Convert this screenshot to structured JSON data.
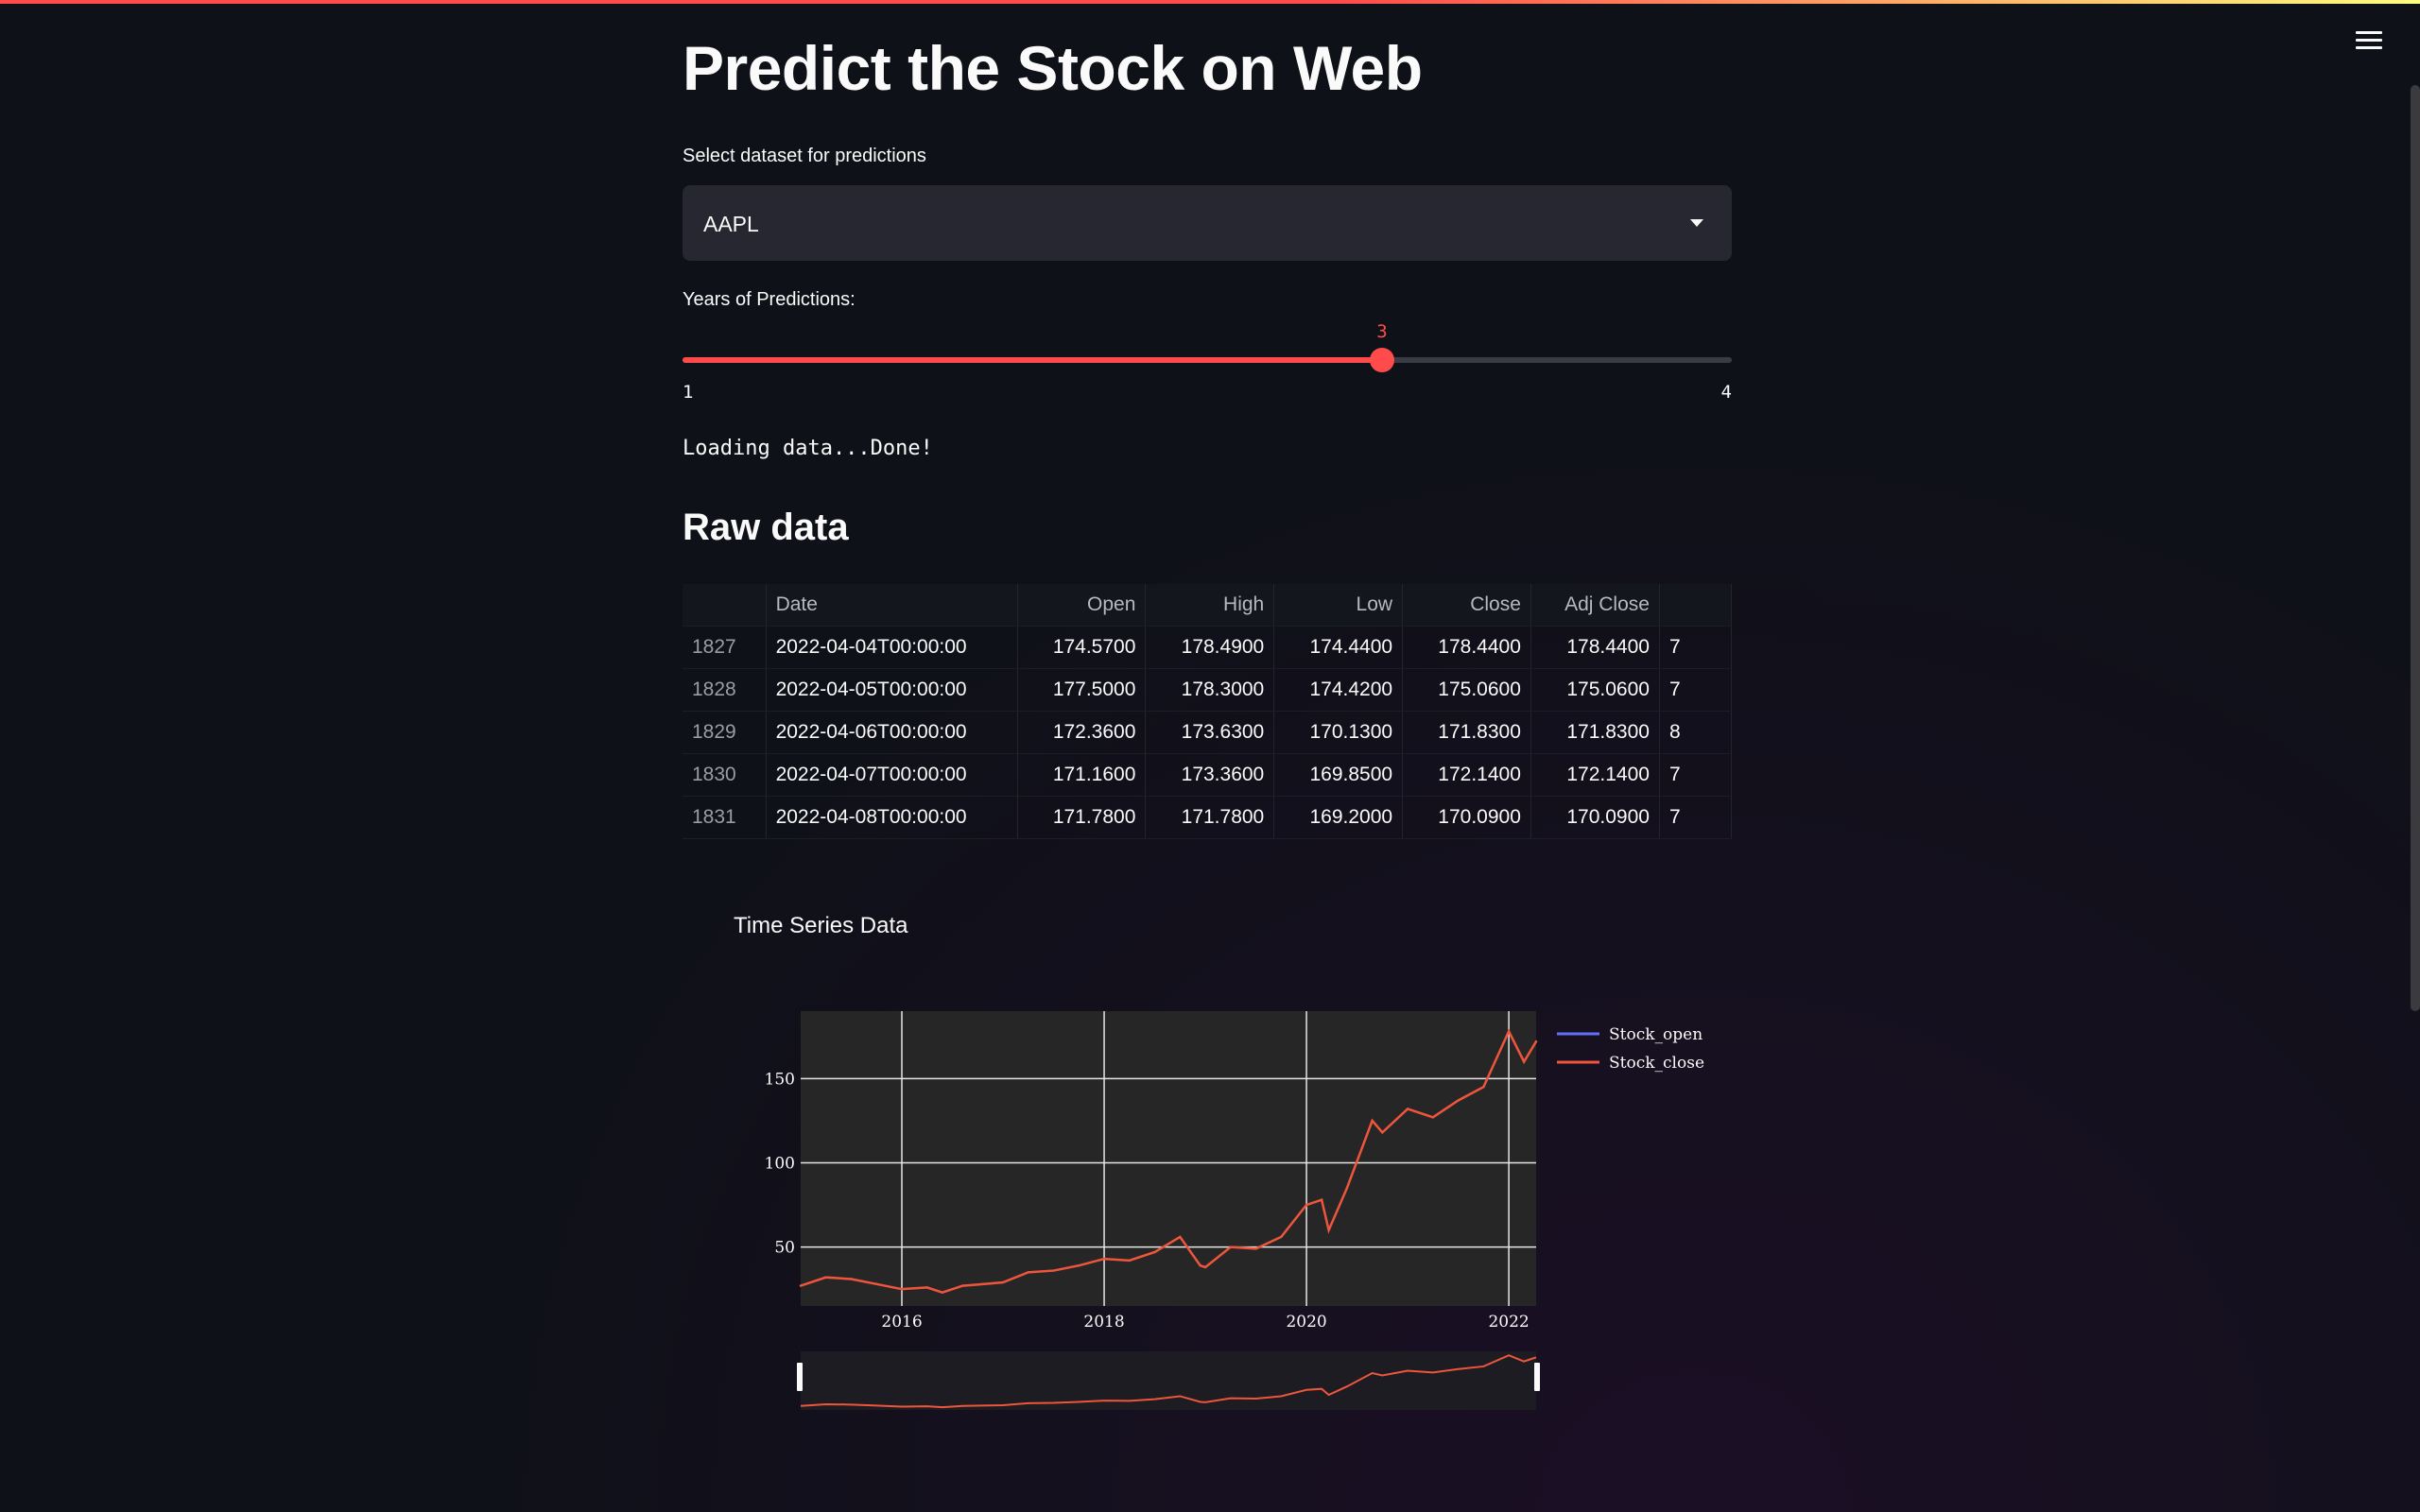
{
  "app": {
    "title": "Predict the Stock on Web",
    "menu_icon": "hamburger-icon"
  },
  "dataset_select": {
    "label": "Select dataset for predictions",
    "value": "AAPL"
  },
  "years_slider": {
    "label": "Years of Predictions:",
    "value": 3,
    "min": 1,
    "max": 4
  },
  "status_text": "Loading data...Done!",
  "raw_data": {
    "heading": "Raw data",
    "columns": [
      "",
      "Date",
      "Open",
      "High",
      "Low",
      "Close",
      "Adj Close",
      ""
    ],
    "rows": [
      [
        "1827",
        "2022-04-04T00:00:00",
        "174.5700",
        "178.4900",
        "174.4400",
        "178.4400",
        "178.4400",
        "7"
      ],
      [
        "1828",
        "2022-04-05T00:00:00",
        "177.5000",
        "178.3000",
        "174.4200",
        "175.0600",
        "175.0600",
        "7"
      ],
      [
        "1829",
        "2022-04-06T00:00:00",
        "172.3600",
        "173.6300",
        "170.1300",
        "171.8300",
        "171.8300",
        "8"
      ],
      [
        "1830",
        "2022-04-07T00:00:00",
        "171.1600",
        "173.3600",
        "169.8500",
        "172.1400",
        "172.1400",
        "7"
      ],
      [
        "1831",
        "2022-04-08T00:00:00",
        "171.7800",
        "171.7800",
        "169.2000",
        "170.0900",
        "170.0900",
        "7"
      ]
    ]
  },
  "colors": {
    "accent": "#ff4b4b",
    "stock_open": "#636efa",
    "stock_close": "#ef553b"
  },
  "chart_data": {
    "type": "line",
    "title": "Time Series Data",
    "xlabel": "",
    "ylabel": "",
    "x_ticks": [
      "2016",
      "2018",
      "2020",
      "2022"
    ],
    "y_ticks": [
      "50",
      "100",
      "150"
    ],
    "xlim": [
      2015.0,
      2022.27
    ],
    "ylim": [
      15,
      190
    ],
    "grid": true,
    "legend": "top-right",
    "range_slider": true,
    "series": [
      {
        "name": "Stock_open",
        "x": [
          2015.0,
          2015.25,
          2015.5,
          2015.75,
          2016.0,
          2016.25,
          2016.4,
          2016.6,
          2016.8,
          2017.0,
          2017.25,
          2017.5,
          2017.75,
          2018.0,
          2018.25,
          2018.5,
          2018.75,
          2018.95,
          2019.0,
          2019.25,
          2019.5,
          2019.75,
          2020.0,
          2020.15,
          2020.22,
          2020.4,
          2020.65,
          2020.75,
          2021.0,
          2021.25,
          2021.5,
          2021.75,
          2022.0,
          2022.15,
          2022.27
        ],
        "y": [
          27,
          32,
          31,
          28,
          25,
          26,
          23,
          27,
          28,
          29,
          35,
          36,
          39,
          43,
          42,
          47,
          56,
          39,
          38,
          50,
          49,
          56,
          75,
          78,
          60,
          85,
          125,
          118,
          132,
          127,
          137,
          145,
          178,
          160,
          172
        ]
      },
      {
        "name": "Stock_close",
        "x": [
          2015.0,
          2015.25,
          2015.5,
          2015.75,
          2016.0,
          2016.25,
          2016.4,
          2016.6,
          2016.8,
          2017.0,
          2017.25,
          2017.5,
          2017.75,
          2018.0,
          2018.25,
          2018.5,
          2018.75,
          2018.95,
          2019.0,
          2019.25,
          2019.5,
          2019.75,
          2020.0,
          2020.15,
          2020.22,
          2020.4,
          2020.65,
          2020.75,
          2021.0,
          2021.25,
          2021.5,
          2021.75,
          2022.0,
          2022.15,
          2022.27
        ],
        "y": [
          27,
          32,
          31,
          28,
          25,
          26,
          23,
          27,
          28,
          29,
          35,
          36,
          39,
          43,
          42,
          47,
          56,
          39,
          38,
          50,
          49,
          56,
          75,
          78,
          60,
          85,
          125,
          118,
          132,
          127,
          137,
          145,
          178,
          160,
          172
        ]
      }
    ]
  }
}
